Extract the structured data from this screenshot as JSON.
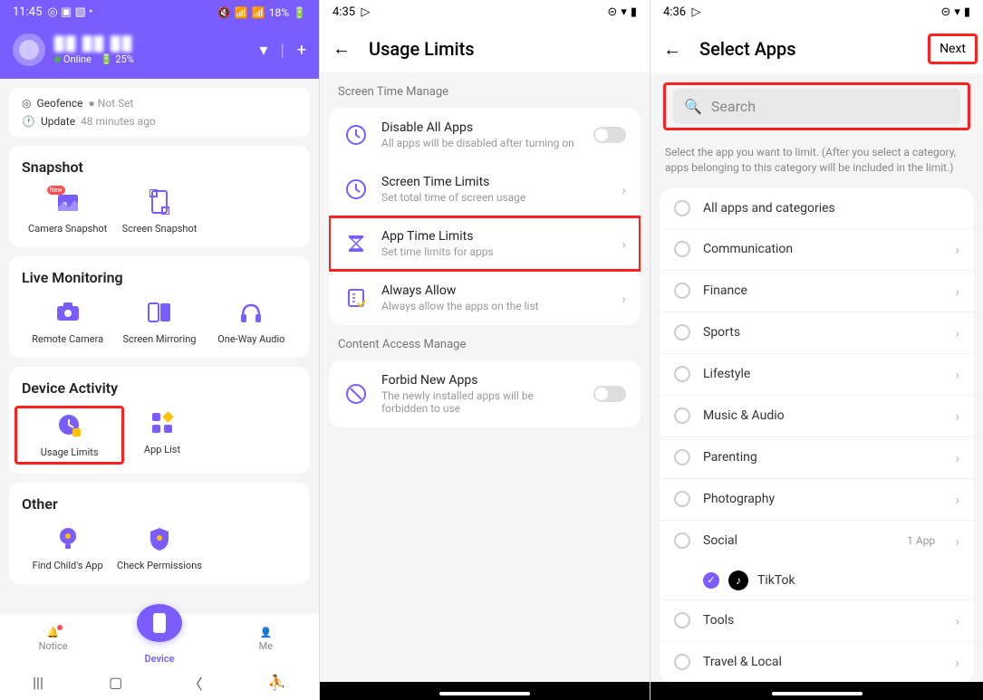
{
  "phone1": {
    "status": {
      "time": "11:45",
      "battery_pct": "18%"
    },
    "profile": {
      "name_obscured": "██ ██ ██",
      "online_label": "Online",
      "battery_label": "25%"
    },
    "subheader": {
      "geofence_label": "Geofence",
      "geofence_value": "Not Set",
      "update_label": "Update",
      "update_value": "48 minutes ago"
    },
    "sections": {
      "snapshot": {
        "title": "Snapshot",
        "items": [
          "Camera Snapshot",
          "Screen Snapshot"
        ]
      },
      "live": {
        "title": "Live Monitoring",
        "items": [
          "Remote Camera",
          "Screen Mirroring",
          "One-Way Audio"
        ]
      },
      "activity": {
        "title": "Device Activity",
        "items": [
          "Usage Limits",
          "App List"
        ]
      },
      "other": {
        "title": "Other",
        "items": [
          "Find Child's App",
          "Check Permissions"
        ]
      }
    },
    "bottomnav": {
      "notice": "Notice",
      "device": "Device",
      "me": "Me"
    }
  },
  "phone2": {
    "status_time": "4:35",
    "title": "Usage Limits",
    "section1_label": "Screen Time Manage",
    "rows": {
      "disable_all": {
        "title": "Disable All Apps",
        "sub": "All apps will be disabled after turning on"
      },
      "screen_time": {
        "title": "Screen Time Limits",
        "sub": "Set total time of screen usage"
      },
      "app_time": {
        "title": "App Time Limits",
        "sub": "Set time limits for apps"
      },
      "always_allow": {
        "title": "Always Allow",
        "sub": "Always allow the apps on the list"
      }
    },
    "section2_label": "Content Access Manage",
    "rows2": {
      "forbid_new": {
        "title": "Forbid New Apps",
        "sub": "The newly installed apps will be forbidden to use"
      }
    }
  },
  "phone3": {
    "status_time": "4:36",
    "title": "Select Apps",
    "next_label": "Next",
    "search_placeholder": "Search",
    "hint": "Select the app you want to limit. (After you select a category, apps belonging to this category will be included in the limit.)",
    "categories": [
      {
        "label": "All apps and categories"
      },
      {
        "label": "Communication"
      },
      {
        "label": "Finance"
      },
      {
        "label": "Sports"
      },
      {
        "label": "Lifestyle"
      },
      {
        "label": "Music & Audio"
      },
      {
        "label": "Parenting"
      },
      {
        "label": "Photography"
      },
      {
        "label": "Social",
        "count": "1 App",
        "checked": false,
        "sub": [
          {
            "label": "TikTok",
            "checked": true
          }
        ]
      },
      {
        "label": "Tools"
      },
      {
        "label": "Travel & Local"
      }
    ]
  }
}
